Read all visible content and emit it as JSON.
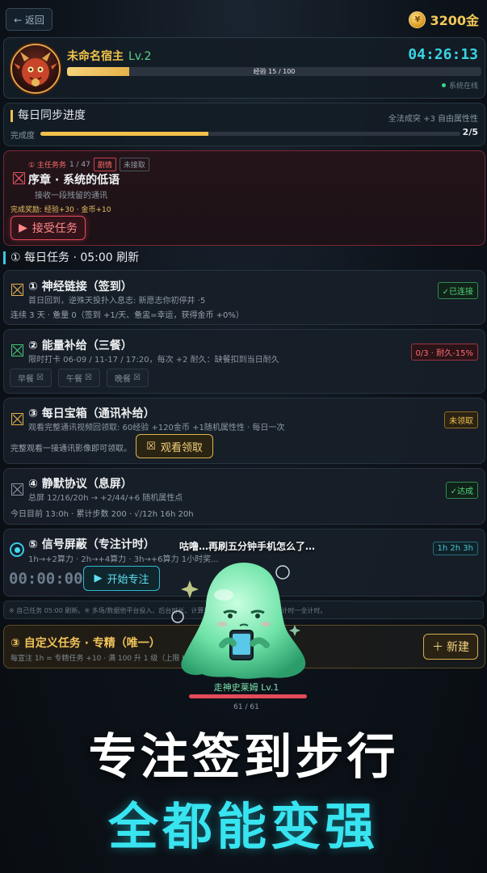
{
  "topbar": {
    "back_label": "← 返回",
    "gold_amount": "3200金",
    "coin_icon": "coin-icon"
  },
  "profile": {
    "name": "未命名宿主",
    "level": "Lv.2",
    "timer": "04:26:13",
    "xp_text": "经验 15 / 100",
    "xp_fraction": 0.15,
    "status": "系统在线",
    "status_color": "#39d68a"
  },
  "daily_sync": {
    "title": "每日同步进度",
    "hint": "全法成突 +3 自由属性性",
    "progress_label": "完成度",
    "progress_value": "2/5",
    "progress_fraction": 0.4
  },
  "main_quest": {
    "label": "① 主任务务",
    "count": "1 / 47",
    "tag_urgent": "剧情",
    "tag_status": "未接取",
    "title": "序章 · 系统的低语",
    "subtitle": "接收一段残留的通讯",
    "reward": "完成奖励: 经验+30 · 金币+10",
    "accept_label": "接受任务"
  },
  "daily_section": {
    "title": "① 每日任务 · 05:00 刷新"
  },
  "tasks": [
    {
      "title": "① 神经链接（签到）",
      "sub": "首日回到，逆殊天投扑入息志: 新愿志你初停井 ·5",
      "line": "连续 3 天 · 惫量 0（签到 +1/天、惫盅=幸运，获得金币 +0%）",
      "badge": "✓已连接",
      "badge_color": "#4fd27c"
    },
    {
      "title": "② 能量补给（三餐）",
      "sub": "限时打卡 06-09 / 11-17 / 17:20，每次 +2 耐久：缺餐扣到当日耐久",
      "badge": "0/3 · 耐久-15%",
      "badge_color": "#e14a55",
      "meals": [
        "早餐",
        "午餐",
        "晚餐"
      ]
    },
    {
      "title": "③ 每日宝箱（通讯补给）",
      "sub": "观看完整通讯视频回领取: 60经验 +120金币 +1随机属性性 · 每日一次",
      "line": "完整观看一接通讯影像即可领取。",
      "badge": "未领取",
      "badge_color": "#e2b24a",
      "action_label": "观看领取"
    },
    {
      "title": "④ 静默协议（息屏）",
      "sub": "总屏 12/16/20h → +2/44/+6 随机属性点",
      "line": "今日目前 13:0h · 累计步数 200 · √/12h 16h 20h",
      "badge": "✓达成",
      "badge_color": "#4fd27c"
    },
    {
      "title": "⑤ 信号屏蔽（专注计时）",
      "sub": "1h→+2算力 · 2h→+4算力 · 3h→+6算力 1小时奖...",
      "badge": "1h 2h 3h",
      "badge_color": "#3fb8c8",
      "timer": "00:00:00",
      "action_label": "开始专注"
    }
  ],
  "notice": "※ 自己任务 05:00 刷新。※ 多场/数据他平台投入、后台时长、计算规则为准，过期仍继续计时计时一全计时。",
  "custom": {
    "title": "③ 自定义任务 · 专精（唯一）",
    "sub": "每宣注 1h = 专精任务 +10 · 满 100 升 1 级（上限 Lv.5）",
    "new_label": "新建"
  },
  "pet": {
    "speech": "咕噜…再刷五分钟手机怎么了…",
    "name": "走神史莱姆 Lv.1",
    "hp_text": "61 / 61",
    "hp_fraction": 1.0,
    "color": "#7fe8b4"
  },
  "slogan": {
    "line1": "专注签到步行",
    "line2": "全都能变强"
  }
}
